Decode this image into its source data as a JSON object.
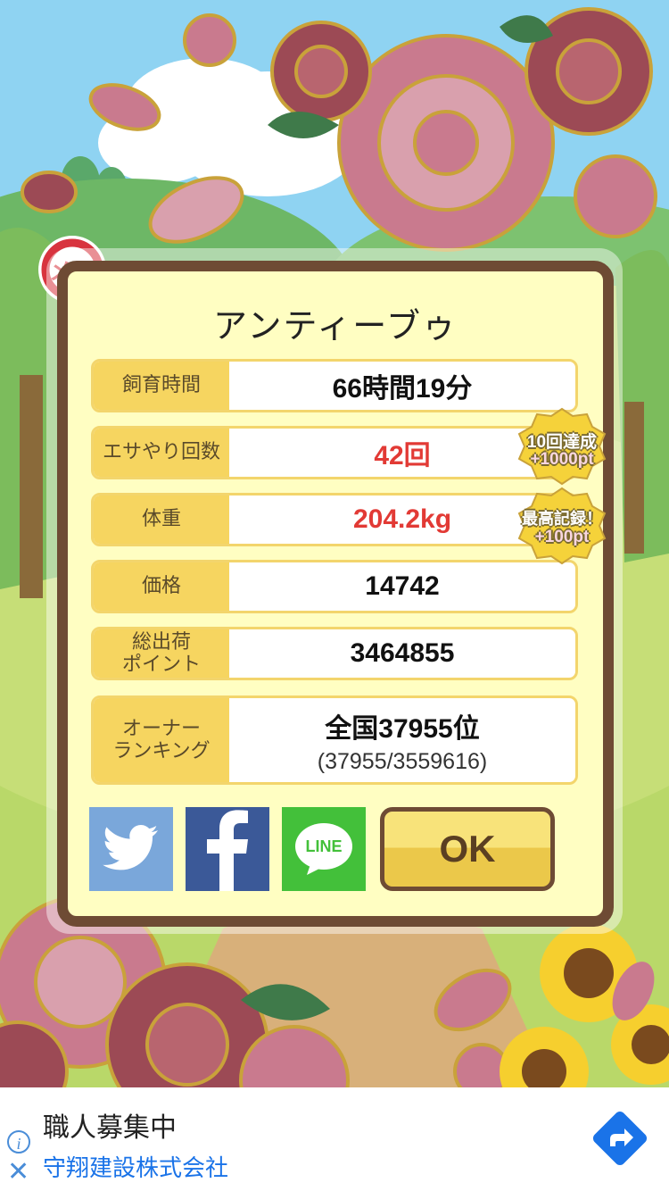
{
  "pet": {
    "name": "アンティーブゥ",
    "gender_icon": "female-symbol",
    "gender_label": "メス"
  },
  "stats": [
    {
      "label": "飼育時間",
      "value": "66時間19分",
      "highlight": false
    },
    {
      "label": "エサやり回数",
      "value": "42回",
      "highlight": true
    },
    {
      "label": "体重",
      "value": "204.2kg",
      "highlight": true
    },
    {
      "label": "価格",
      "value": "14742",
      "highlight": false
    },
    {
      "label": "総出荷\nポイント",
      "value": "3464855",
      "highlight": false
    },
    {
      "label": "オーナー\nランキング",
      "value": "全国37955位",
      "sub": "(37955/3559616)",
      "highlight": false
    }
  ],
  "bonuses": [
    {
      "line1": "10回達成",
      "line2": "+1000pt"
    },
    {
      "line1": "最高記録！",
      "line2": "+100pt"
    }
  ],
  "share": {
    "twitter_icon": "twitter-bird-icon",
    "facebook_icon": "facebook-f-icon",
    "line_label": "LINE"
  },
  "ok_label": "OK",
  "ad": {
    "title": "職人募集中",
    "advertiser": "守翔建設株式会社"
  },
  "colors": {
    "highlight_red": "#e23a35",
    "card_border": "#6e4b34",
    "label_yellow": "#f6d560",
    "twitter": "#7aa7da",
    "facebook": "#3b5998",
    "line": "#43c03a"
  }
}
